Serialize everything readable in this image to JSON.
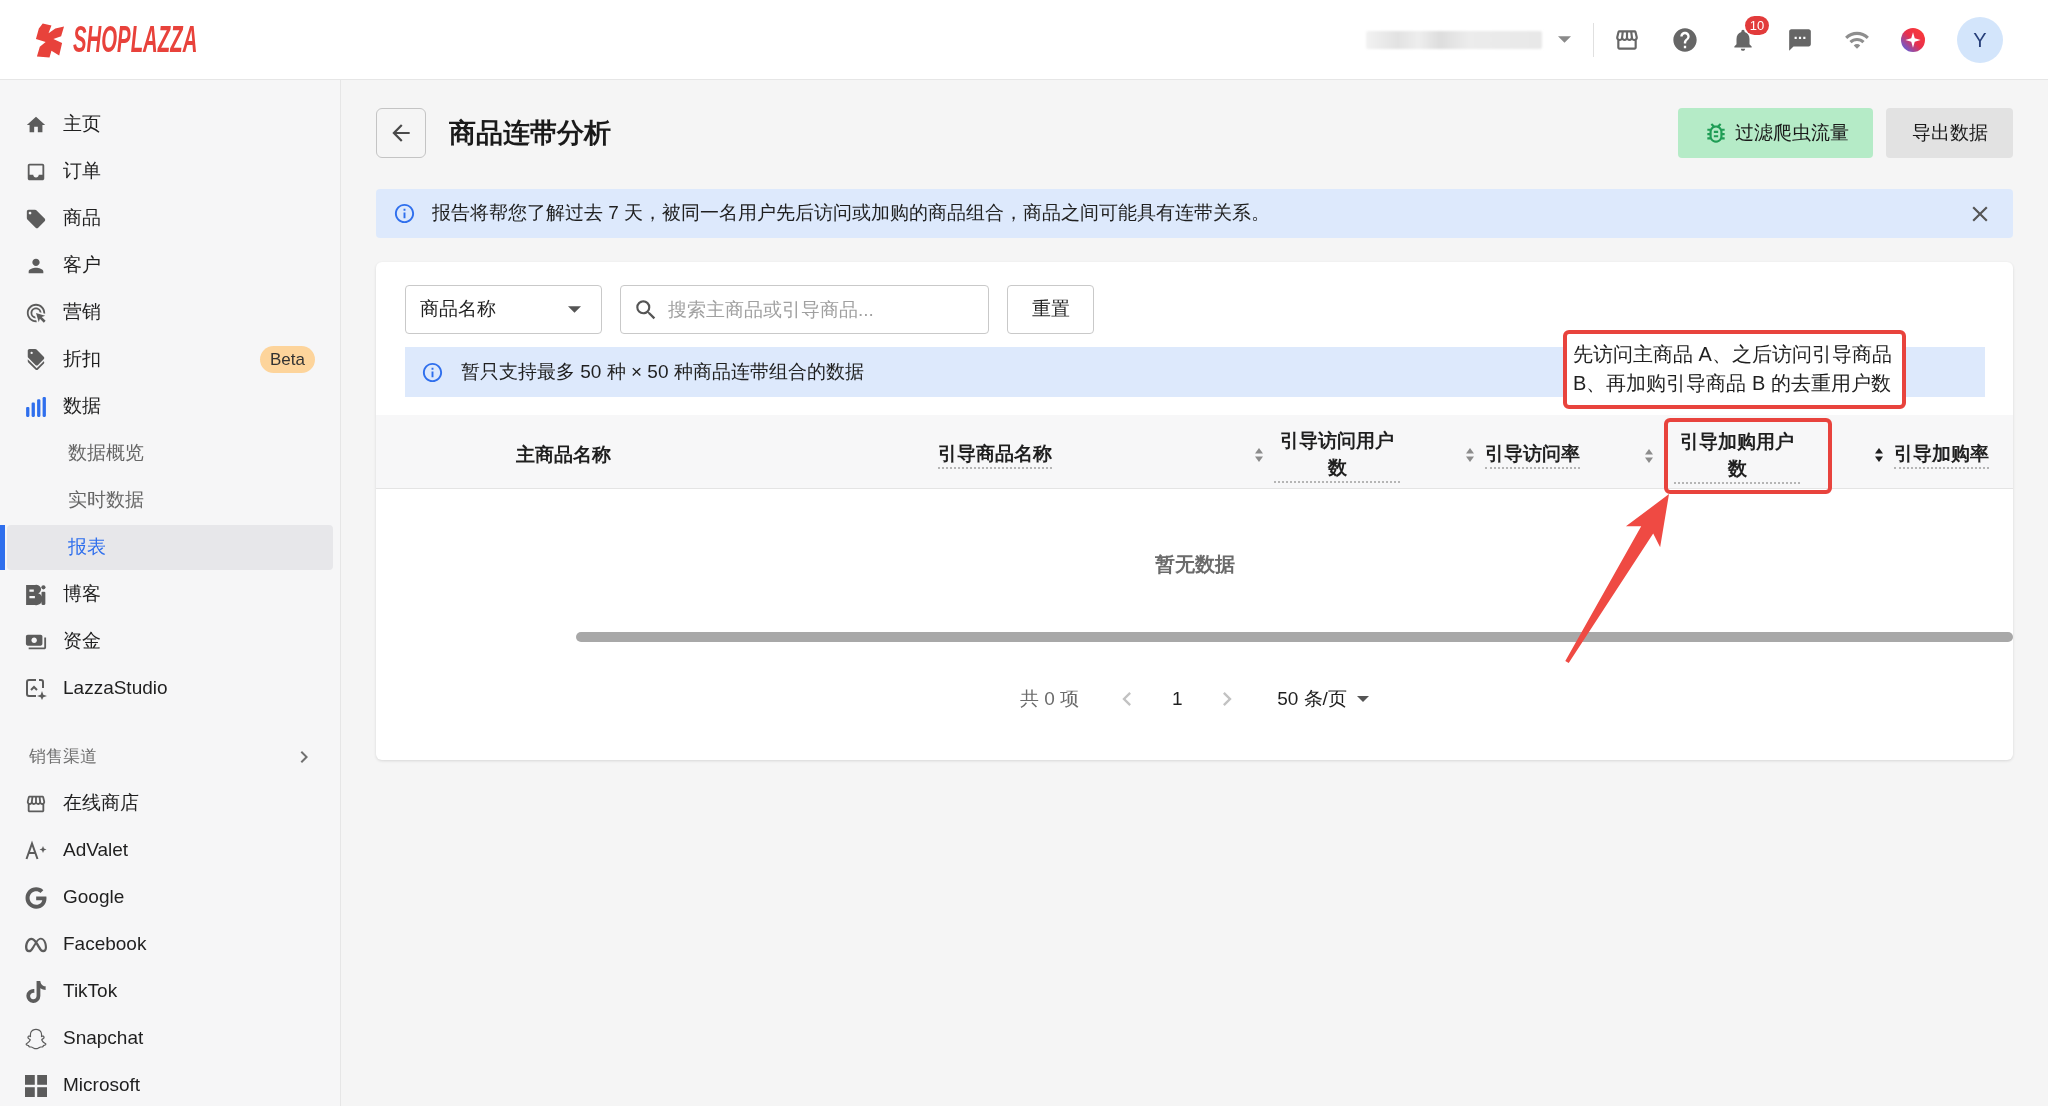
{
  "header": {
    "logo": "SHOPLAZZA",
    "notification_count": "10",
    "avatar_initial": "Y"
  },
  "sidebar": {
    "items": [
      {
        "label": "主页",
        "selected": false
      },
      {
        "label": "订单",
        "selected": false
      },
      {
        "label": "商品",
        "selected": false
      },
      {
        "label": "客户",
        "selected": false
      },
      {
        "label": "营销",
        "selected": false
      },
      {
        "label": "折扣",
        "selected": false,
        "badge": "Beta"
      },
      {
        "label": "数据",
        "selected": false,
        "children": [
          {
            "label": "数据概览",
            "selected": false
          },
          {
            "label": "实时数据",
            "selected": false
          },
          {
            "label": "报表",
            "selected": true
          }
        ]
      },
      {
        "label": "博客",
        "selected": false
      },
      {
        "label": "资金",
        "selected": false
      },
      {
        "label": "LazzaStudio",
        "selected": false
      }
    ],
    "sections": [
      {
        "title": "销售渠道",
        "items": [
          {
            "label": "在线商店",
            "selected": false
          },
          {
            "label": "AdValet",
            "selected": false
          },
          {
            "label": "Google",
            "selected": false
          },
          {
            "label": "Facebook",
            "selected": false
          },
          {
            "label": "TikTok",
            "selected": false
          },
          {
            "label": "Snapchat",
            "selected": false
          },
          {
            "label": "Microsoft",
            "selected": false
          }
        ]
      }
    ]
  },
  "page": {
    "title": "商品连带分析",
    "actions": [
      {
        "label": "过滤爬虫流量",
        "kind": "filter"
      },
      {
        "label": "导出数据",
        "kind": "export"
      }
    ],
    "banner": {
      "text": "报告将帮您了解过去 7 天，被同一名用户先后访问或加购的商品组合，商品之间可能具有连带关系。"
    },
    "filters": {
      "field_select": {
        "value": "商品名称"
      },
      "search": {
        "placeholder": "搜索主商品或引导商品..."
      },
      "reset": "重置"
    },
    "notice": "暂只支持最多 50 种 × 50 种商品连带组合的数据",
    "table": {
      "columns": [
        {
          "label": "主商品名称",
          "sortable": false,
          "sorted": false,
          "hint": false,
          "highlighted": false
        },
        {
          "label": "引导商品名称",
          "sortable": false,
          "sorted": false,
          "hint": true,
          "highlighted": false
        },
        {
          "label": "引导访问用户数",
          "sortable": true,
          "sorted": false,
          "hint": true,
          "highlighted": false
        },
        {
          "label": "引导访问率",
          "sortable": true,
          "sorted": false,
          "hint": true,
          "highlighted": false
        },
        {
          "label": "引导加购用户数",
          "sortable": true,
          "sorted": false,
          "hint": true,
          "highlighted": true,
          "tooltip": "先访问主商品 A、之后访问引导商品 B、再加购引导商品 B 的去重用户数"
        },
        {
          "label": "引导加购率",
          "sortable": true,
          "sorted": true,
          "hint": true,
          "highlighted": false
        }
      ],
      "empty_text": "暂无数据"
    },
    "pagination": {
      "total": "共 0 项",
      "prev": {
        "disabled": true
      },
      "page": "1",
      "next": {
        "disabled": true
      },
      "page_size": "50 条/页"
    }
  }
}
